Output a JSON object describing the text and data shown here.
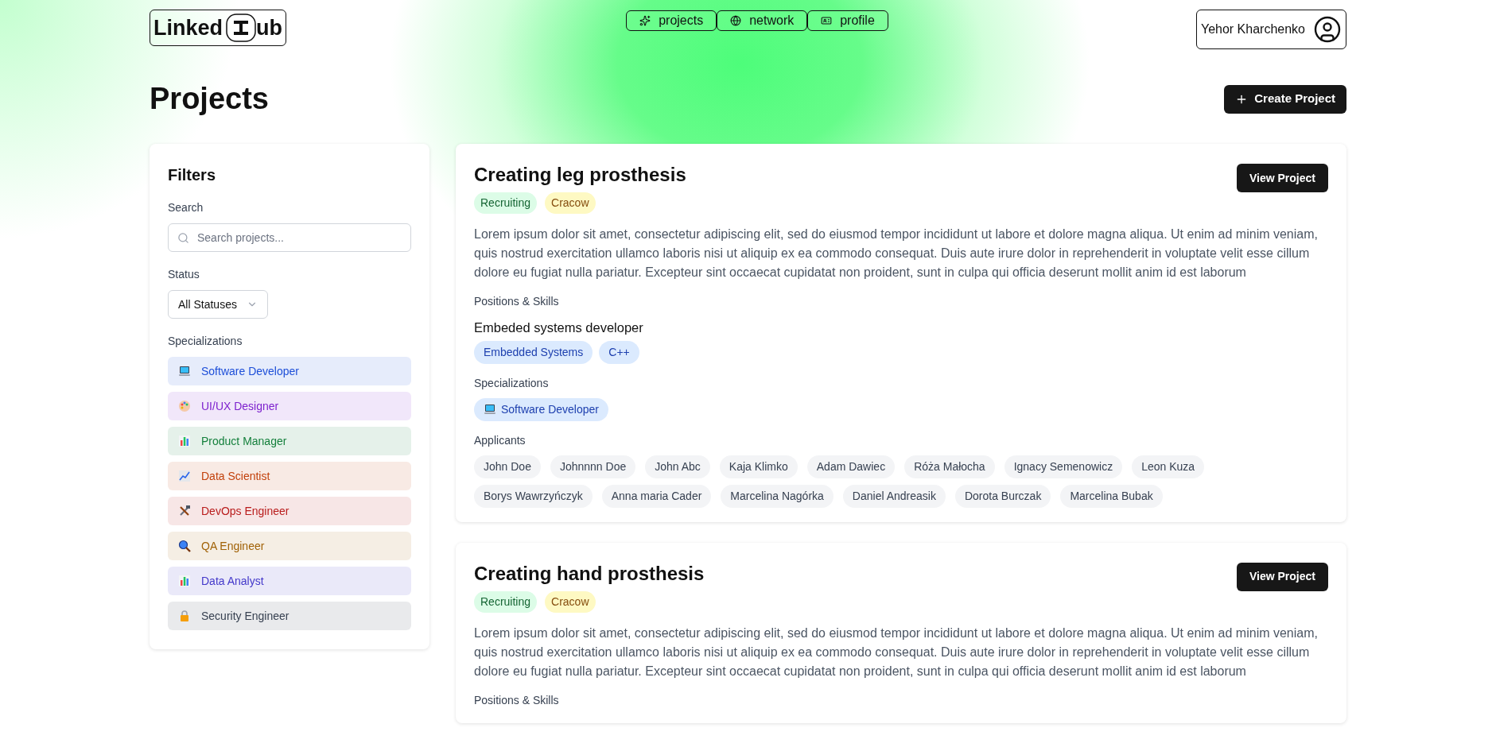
{
  "header": {
    "logo": {
      "left": "Linked",
      "right": "ub"
    },
    "nav": [
      {
        "label": "projects",
        "selected": false
      },
      {
        "label": "network",
        "selected": false
      },
      {
        "label": "profile",
        "selected": false
      }
    ],
    "user": {
      "name": "Yehor Kharchenko"
    }
  },
  "page": {
    "title": "Projects",
    "create_button": "Create Project"
  },
  "filters": {
    "title": "Filters",
    "search_label": "Search",
    "search": {
      "placeholder": "Search projects..."
    },
    "status_label": "Status",
    "status_value": "All Statuses",
    "specializations_label": "Specializations",
    "specializations": [
      {
        "label": "Software Developer",
        "color": "#1d4ed8"
      },
      {
        "label": "UI/UX Designer",
        "color": "#7e22ce"
      },
      {
        "label": "Product Manager",
        "color": "#15803d"
      },
      {
        "label": "Data Scientist",
        "color": "#c2410c"
      },
      {
        "label": "DevOps Engineer",
        "color": "#b91c1c"
      },
      {
        "label": "QA Engineer",
        "color": "#a16207"
      },
      {
        "label": "Data Analyst",
        "color": "#4338ca"
      },
      {
        "label": "Security Engineer",
        "color": "#374151"
      }
    ]
  },
  "projects": [
    {
      "title": "Creating leg prosthesis",
      "button": "View Project",
      "tags": [
        {
          "label": "Recruiting",
          "kind": "status"
        },
        {
          "label": "Cracow",
          "kind": "location"
        }
      ],
      "description": "Lorem ipsum dolor sit amet, consectetur adipiscing elit, sed do eiusmod tempor incididunt ut labore et dolore magna aliqua. Ut enim ad minim veniam, quis nostrud exercitation ullamco laboris nisi ut aliquip ex ea commodo consequat. Duis aute irure dolor in reprehenderit in voluptate velit esse cillum dolore eu fugiat nulla pariatur. Excepteur sint occaecat cupidatat non proident, sunt in culpa qui officia deserunt mollit anim id est laborum",
      "positions_label": "Positions & Skills",
      "positions": [
        {
          "title": "Embeded systems developer",
          "skills": [
            "Embedded Systems",
            "C++"
          ]
        }
      ],
      "specializations_label": "Specializations",
      "specializations": [
        "Software Developer"
      ],
      "applicants_label": "Applicants",
      "applicants": [
        "John Doe",
        "Johnnnn Doe",
        "John Abc",
        "Kaja Klimko",
        "Adam Dawiec",
        "Róża Małocha",
        "Ignacy Semenowicz",
        "Leon Kuza",
        "Borys Wawrzyńczyk",
        "Anna maria Cader",
        "Marcelina Nagórka",
        "Daniel Andreasik",
        "Dorota Burczak",
        "Marcelina Bubak"
      ]
    },
    {
      "title": "Creating hand prosthesis",
      "button": "View Project",
      "tags": [
        {
          "label": "Recruiting",
          "kind": "status"
        },
        {
          "label": "Cracow",
          "kind": "location"
        }
      ],
      "description": "Lorem ipsum dolor sit amet, consectetur adipiscing elit, sed do eiusmod tempor incididunt ut labore et dolore magna aliqua. Ut enim ad minim veniam, quis nostrud exercitation ullamco laboris nisi ut aliquip ex ea commodo consequat. Duis aute irure dolor in reprehenderit in voluptate velit esse cillum dolore eu fugiat nulla pariatur. Excepteur sint occaecat cupidatat non proident, sunt in culpa qui officia deserunt mollit anim id est laborum",
      "positions_label": "Positions & Skills"
    }
  ]
}
